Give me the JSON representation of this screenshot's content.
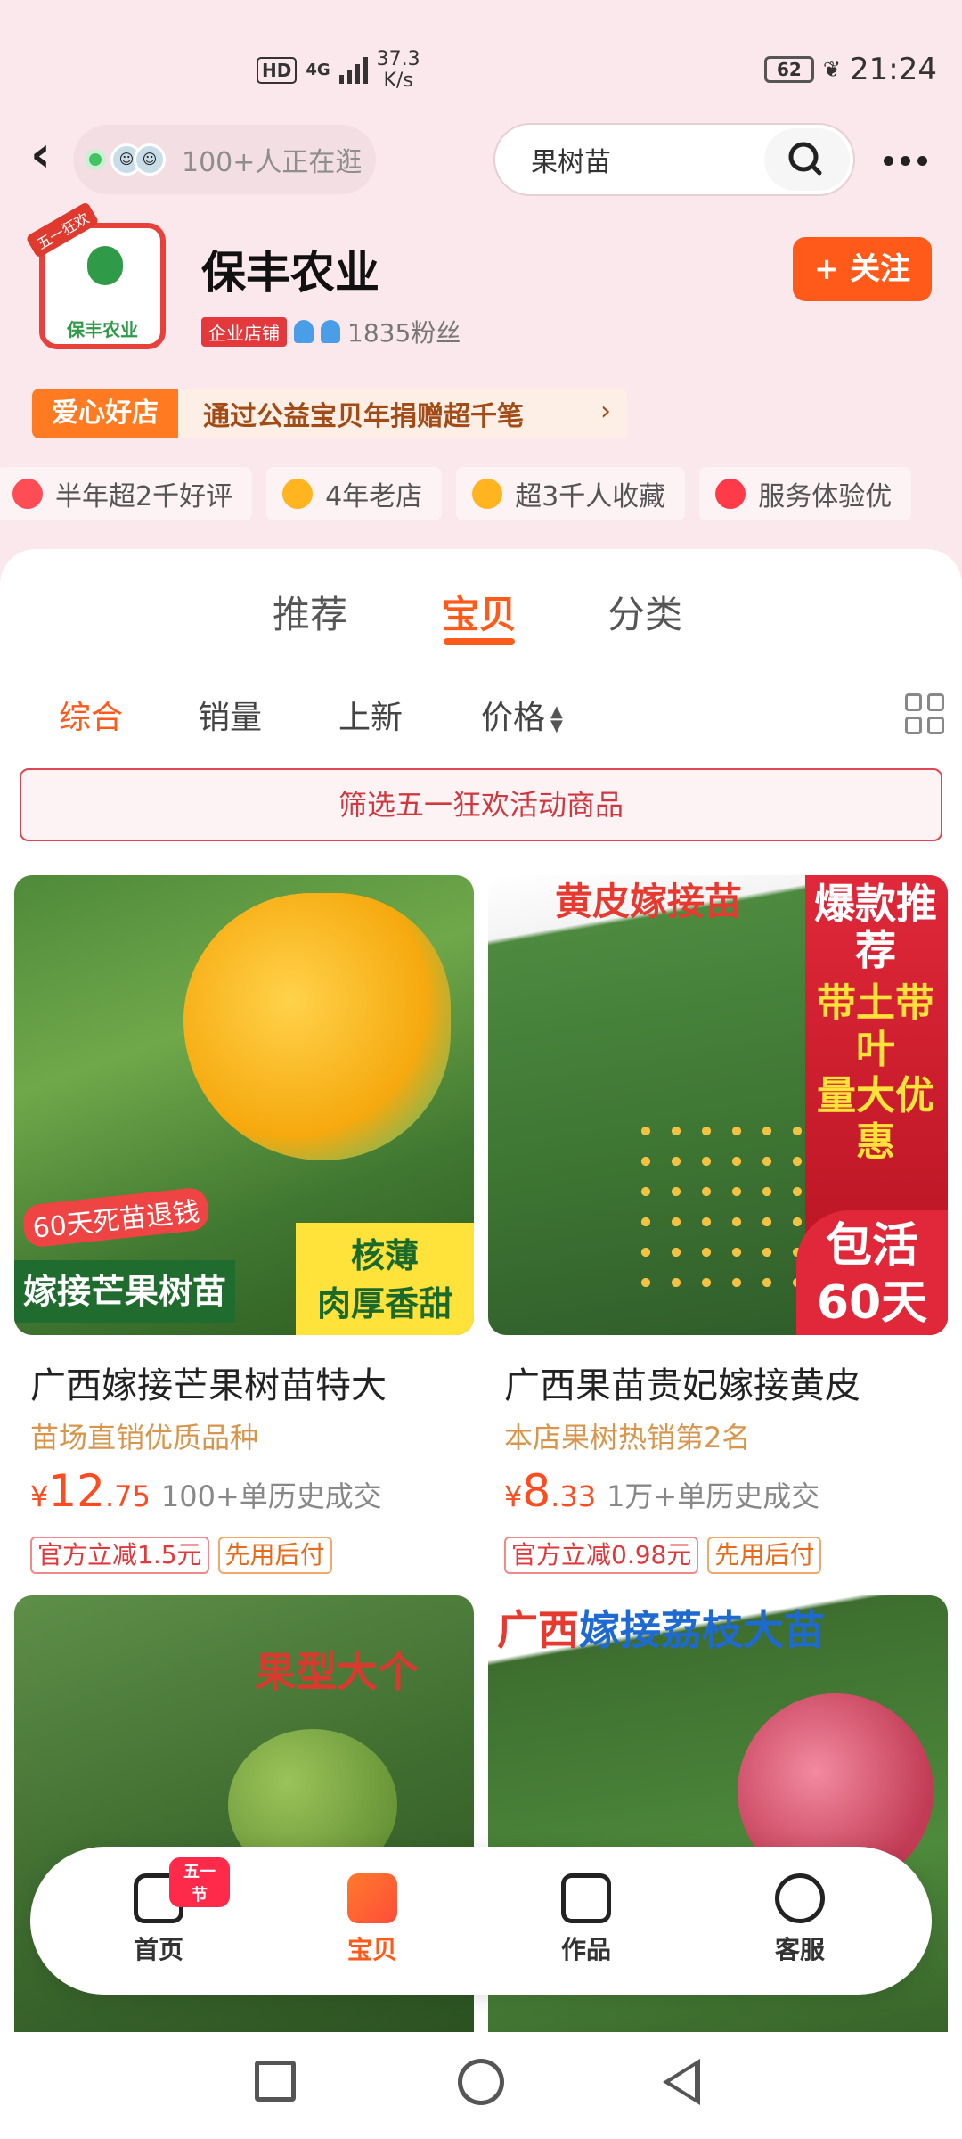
{
  "status_bar": {
    "hd": "HD",
    "network": "4G",
    "speed_value": "37.3",
    "speed_unit": "K/s",
    "battery": "62",
    "time": "21:24"
  },
  "header": {
    "visitors_text": "100+人正在逛",
    "search_value": "果树苗",
    "icons": [
      "back-icon",
      "search-icon",
      "more-icon"
    ]
  },
  "shop": {
    "logo_ribbon": "五一狂欢",
    "logo_text": "保丰农业",
    "name": "保丰农业",
    "badge": "企业店铺",
    "fans": "1835粉丝",
    "follow_label": "+ 关注"
  },
  "love_banner": {
    "tag": "爱心好店",
    "text": "通过公益宝贝年捐赠超千笔",
    "arrow": "›"
  },
  "chips": [
    {
      "label": "半年超2千好评",
      "icon": "thumb-up-icon"
    },
    {
      "label": "4年老店",
      "icon": "shop-icon"
    },
    {
      "label": "超3千人收藏",
      "icon": "star-icon"
    },
    {
      "label": "服务体验优",
      "icon": "service-icon"
    }
  ],
  "tabs": [
    {
      "label": "推荐",
      "active": false
    },
    {
      "label": "宝贝",
      "active": true
    },
    {
      "label": "分类",
      "active": false
    }
  ],
  "sorts": [
    {
      "label": "综合",
      "active": true
    },
    {
      "label": "销量",
      "active": false
    },
    {
      "label": "上新",
      "active": false
    },
    {
      "label": "价格",
      "active": false
    }
  ],
  "filter_label": "筛选五一狂欢活动商品",
  "products": [
    {
      "image_text_1": "60天死苗退钱",
      "image_text_2": "嫁接芒果树苗",
      "image_text_3": "核薄",
      "image_text_4": "肉厚香甜",
      "title": "广西嫁接芒果树苗特大",
      "subtitle": "苗场直销优质品种",
      "currency": "¥",
      "price_int": "12",
      "price_dec": ".75",
      "sold": "100+单历史成交",
      "tags": [
        "官方立减1.5元",
        "先用后付"
      ]
    },
    {
      "image_text_1": "黄皮嫁接苗",
      "image_text_2": "爆款推荐",
      "image_text_3": "带土带叶",
      "image_text_4": "量大优惠",
      "image_text_5": "包活",
      "image_text_6": "60天",
      "title": "广西果苗贵妃嫁接黄皮",
      "subtitle": "本店果树热销第2名",
      "currency": "¥",
      "price_int": "8",
      "price_dec": ".33",
      "sold": "1万+单历史成交",
      "tags": [
        "官方立减0.98元",
        "先用后付"
      ]
    },
    {
      "image_text_1": "果型大个"
    },
    {
      "image_text_1": "广西",
      "image_text_2": "嫁接荔枝大苗"
    }
  ],
  "bottom_nav": [
    {
      "label": "首页",
      "icon": "home-icon",
      "badge": "五一节",
      "active": false
    },
    {
      "label": "宝贝",
      "icon": "bag-icon",
      "active": true
    },
    {
      "label": "作品",
      "icon": "works-icon",
      "active": false
    },
    {
      "label": "客服",
      "icon": "customer-service-icon",
      "active": false
    }
  ],
  "colors": {
    "accent": "#ff5a1a",
    "page_bg": "#fbe8ec",
    "price": "#ff4b1f"
  }
}
